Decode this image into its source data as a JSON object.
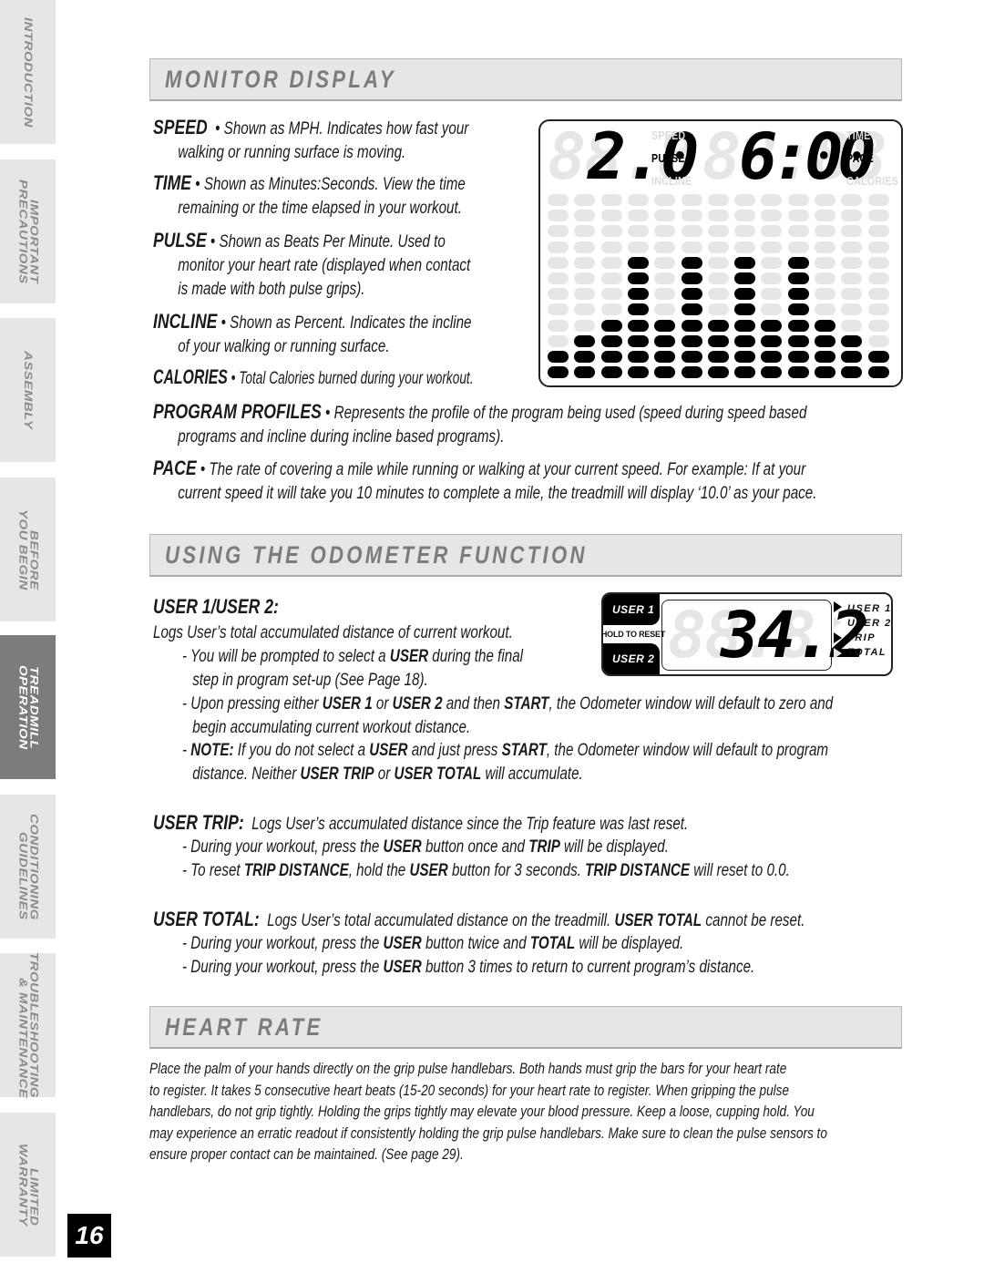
{
  "sidebar": {
    "tabs": [
      {
        "label": "INTRODUCTION",
        "active": false
      },
      {
        "label": "IMPORTANT\nPRECAUTIONS",
        "active": false
      },
      {
        "label": "ASSEMBLY",
        "active": false
      },
      {
        "label": "BEFORE\nYOU BEGIN",
        "active": false
      },
      {
        "label": "TREADMILL\nOPERATION",
        "active": true
      },
      {
        "label": "CONDITIONING\nGUIDELINES",
        "active": false
      },
      {
        "label": "TROUBLESHOOTING\n& MAINTENANCE",
        "active": false
      },
      {
        "label": "LIMITED\nWARRANTY",
        "active": false
      }
    ]
  },
  "page_number": "16",
  "sections": {
    "monitor": {
      "title": "MONITOR DISPLAY",
      "items": {
        "speed": {
          "term": "SPEED",
          "text": "Shown as MPH. Indicates how fast your",
          "cont": "walking or running surface is moving."
        },
        "time": {
          "term": "TIME",
          "text": "Shown as Minutes:Seconds. View the time",
          "cont": "remaining or the time elapsed in your workout."
        },
        "pulse": {
          "term": "PULSE",
          "text": "Shown as Beats Per Minute. Used to",
          "cont1": "monitor your heart rate (displayed when contact",
          "cont2": "is made with both pulse grips)."
        },
        "incline": {
          "term": "INCLINE",
          "text": "Shown as Percent. Indicates the incline",
          "cont": "of your walking or running surface."
        },
        "calories": {
          "term": "CALORIES",
          "text": "Total Calories burned during your workout."
        },
        "profiles": {
          "term": "PROGRAM PROFILES",
          "text": "Represents the profile of the program being used (speed during speed based",
          "cont": "programs and incline during incline based programs)."
        },
        "pace": {
          "term": "PACE",
          "text": "The rate of covering a mile while running or walking at your current speed. For example: If at your",
          "cont": "current speed it will take you 10 minutes to complete a mile, the treadmill will display ‘10.0’ as your pace."
        }
      },
      "display": {
        "left_value": "2.0",
        "left_ghost": "88.8",
        "right_value": "6:00",
        "right_ghost": "88:88",
        "left_labels": [
          {
            "text": "SPEED",
            "lit": false
          },
          {
            "text": "PULSE",
            "lit": true
          },
          {
            "text": "INCLINE",
            "lit": false
          }
        ],
        "right_labels": [
          {
            "text": "TIME",
            "lit": false
          },
          {
            "text": "PACE",
            "lit": true
          },
          {
            "text": "CALORIES",
            "lit": false
          }
        ],
        "profile_rows": 12,
        "profile_columns": [
          2,
          3,
          4,
          8,
          4,
          8,
          4,
          8,
          4,
          8,
          4,
          3,
          2
        ]
      }
    },
    "odometer": {
      "title": "USING THE ODOMETER FUNCTION",
      "user_heading": "USER 1/USER 2:",
      "user_desc": "Logs User’s total accumulated distance of current workout.",
      "bullets": [
        {
          "parts": [
            [
              "- You will be prompted to select a ",
              false
            ],
            [
              "USER",
              true
            ],
            [
              " during the final",
              false
            ]
          ],
          "cont": "step in program set-up (See Page 18)."
        },
        {
          "parts": [
            [
              "- Upon pressing either ",
              false
            ],
            [
              "USER 1",
              true
            ],
            [
              " or ",
              false
            ],
            [
              "USER 2",
              true
            ],
            [
              " and then ",
              false
            ],
            [
              "START",
              true
            ],
            [
              ", the Odometer window will default to zero and",
              false
            ]
          ],
          "cont": "begin accumulating current workout distance."
        },
        {
          "parts": [
            [
              "- ",
              false
            ],
            [
              "NOTE:",
              true
            ],
            [
              " If you do not select a ",
              false
            ],
            [
              "USER",
              true
            ],
            [
              " and just press ",
              false
            ],
            [
              "START",
              true
            ],
            [
              ", the Odometer window will default to program",
              false
            ]
          ],
          "cont_parts": [
            [
              "distance. Neither ",
              false
            ],
            [
              "USER TRIP",
              true
            ],
            [
              " or ",
              false
            ],
            [
              "USER TOTAL",
              true
            ],
            [
              " will accumulate.",
              false
            ]
          ]
        }
      ],
      "trip": {
        "term": "USER TRIP:",
        "text": "Logs User’s accumulated distance since the Trip feature was last reset.",
        "bullets": [
          [
            [
              "- During your workout, press the ",
              false
            ],
            [
              "USER",
              true
            ],
            [
              " button once and ",
              false
            ],
            [
              "TRIP",
              true
            ],
            [
              " will be displayed.",
              false
            ]
          ],
          [
            [
              "- To reset ",
              false
            ],
            [
              "TRIP DISTANCE",
              true
            ],
            [
              ", hold the ",
              false
            ],
            [
              "USER",
              true
            ],
            [
              " button for 3 seconds. ",
              false
            ],
            [
              "TRIP DISTANCE",
              true
            ],
            [
              " will reset to 0.0.",
              false
            ]
          ]
        ]
      },
      "total": {
        "term": "USER TOTAL:",
        "text_parts": [
          [
            "Logs User’s total accumulated distance on the treadmill. ",
            false
          ],
          [
            "USER TOTAL",
            true
          ],
          [
            " cannot be reset.",
            false
          ]
        ],
        "bullets": [
          [
            [
              "- During your workout, press the ",
              false
            ],
            [
              "USER",
              true
            ],
            [
              " button twice and ",
              false
            ],
            [
              "TOTAL",
              true
            ],
            [
              " will be displayed.",
              false
            ]
          ],
          [
            [
              "- During your workout, press the ",
              false
            ],
            [
              "USER",
              true
            ],
            [
              " button 3 times to return to current program’s distance.",
              false
            ]
          ]
        ]
      },
      "panel": {
        "user1_button": "USER 1",
        "hold_label": "HOLD TO RESET",
        "user2_button": "USER 2",
        "value": "34.2",
        "ghost": "88.8",
        "indicators": [
          {
            "label": "USER 1",
            "lit": true
          },
          {
            "label": "USER 2",
            "lit": false
          },
          {
            "label": "TRIP",
            "lit": true
          },
          {
            "label": "TOTAL",
            "lit": false
          }
        ]
      }
    },
    "heart_rate": {
      "title": "HEART RATE",
      "lines": [
        "Place the palm of your hands directly on the grip pulse handlebars. Both hands must grip the bars for your heart rate",
        "to register. It takes 5 consecutive heart beats (15-20 seconds) for your heart rate to register. When gripping the pulse",
        "handlebars, do not grip tightly. Holding the grips tightly may elevate your blood pressure. Keep a loose, cupping hold. You",
        "may experience an erratic readout if consistently holding the grip pulse handlebars. Make sure to clean the pulse sensors to",
        "ensure proper contact can be maintained. (See page 29)."
      ]
    }
  }
}
